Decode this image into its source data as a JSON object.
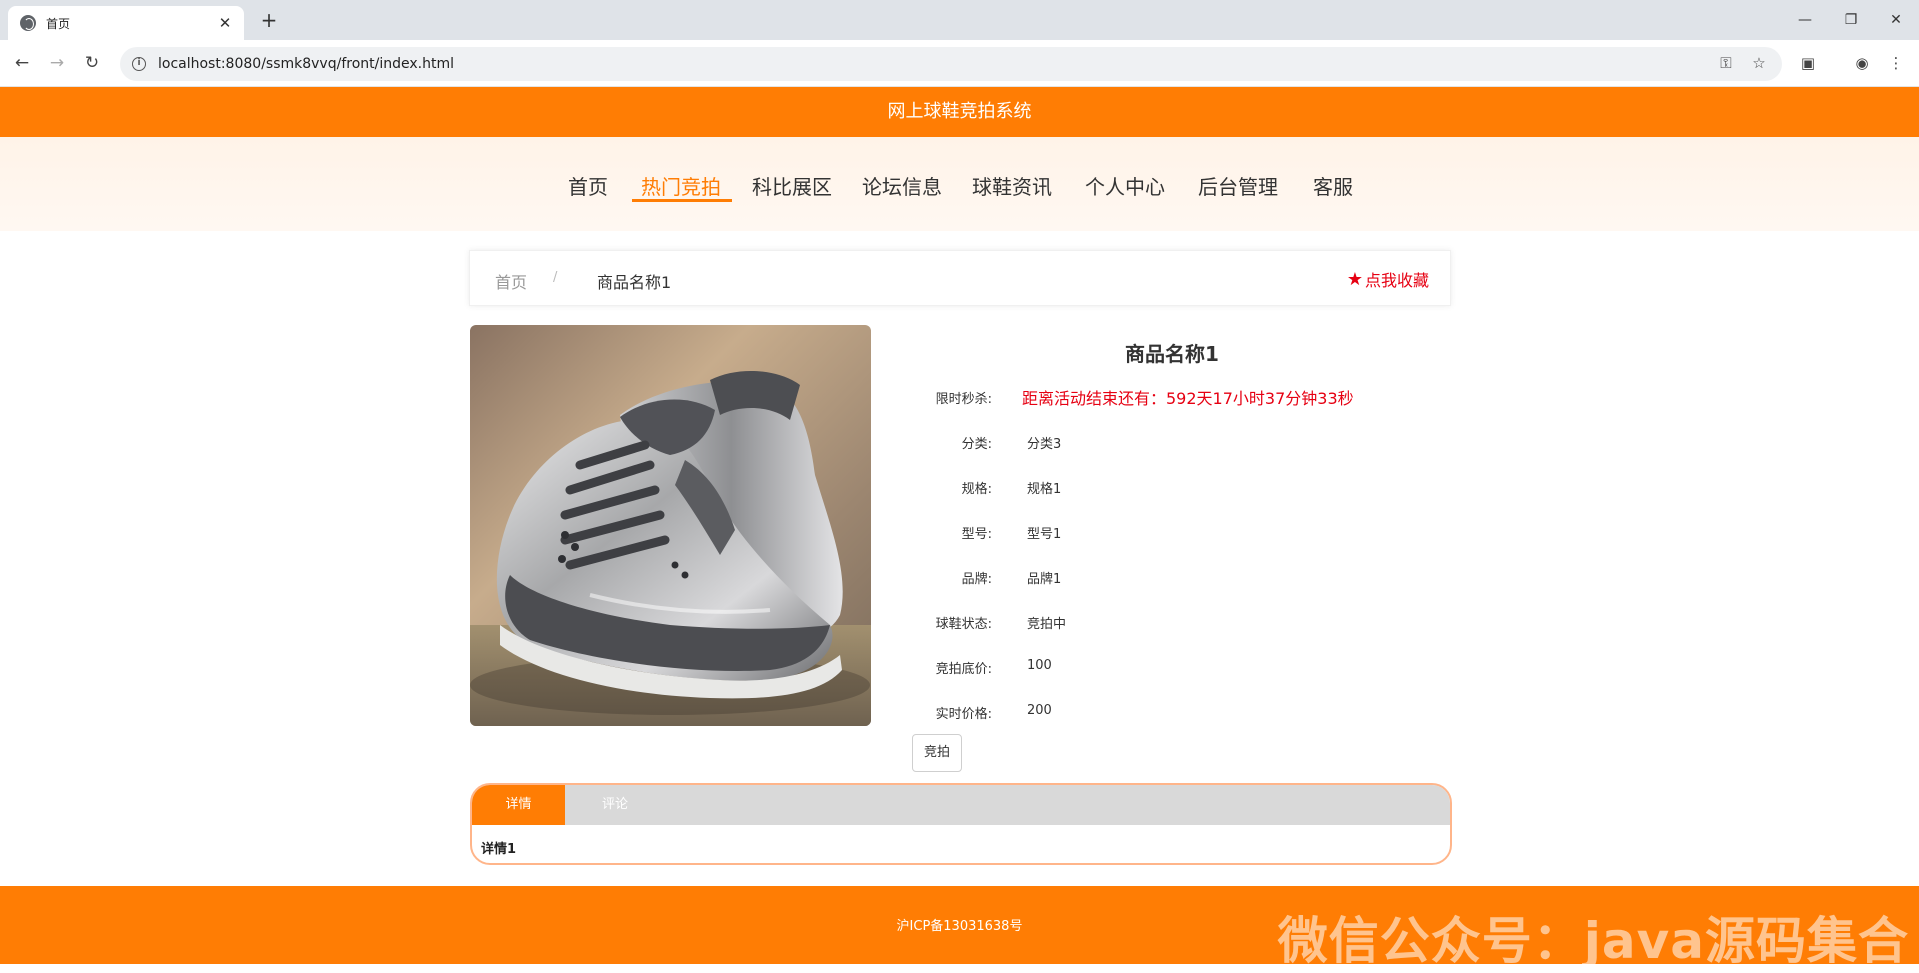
{
  "browser": {
    "tab_title": "首页",
    "url": "localhost:8080/ssmk8vvq/front/index.html"
  },
  "site": {
    "title": "网上球鞋竞拍系统",
    "nav": [
      {
        "label": "首页",
        "active": false
      },
      {
        "label": "热门竞拍",
        "active": true
      },
      {
        "label": "科比展区",
        "active": false
      },
      {
        "label": "论坛信息",
        "active": false
      },
      {
        "label": "球鞋资讯",
        "active": false
      },
      {
        "label": "个人中心",
        "active": false
      },
      {
        "label": "后台管理",
        "active": false
      },
      {
        "label": "客服",
        "active": false
      }
    ]
  },
  "breadcrumb": {
    "home": "首页",
    "separator": "/",
    "current": "商品名称1",
    "favorite": "点我收藏"
  },
  "product": {
    "name": "商品名称1",
    "flash_sale_label": "限时秒杀:",
    "countdown": "距离活动结束还有：592天17小时37分钟33秒",
    "fields": [
      {
        "label": "分类:",
        "value": "分类3"
      },
      {
        "label": "规格:",
        "value": "规格1"
      },
      {
        "label": "型号:",
        "value": "型号1"
      },
      {
        "label": "品牌:",
        "value": "品牌1"
      },
      {
        "label": "球鞋状态:",
        "value": "竞拍中"
      },
      {
        "label": "竞拍底价:",
        "value": "100"
      },
      {
        "label": "实时价格:",
        "value": "200"
      }
    ],
    "bid_button": "竞拍"
  },
  "tabs": {
    "detail": "详情",
    "comment": "评论",
    "content": "详情1"
  },
  "footer": {
    "icp": "沪ICP备13031638号",
    "watermark": "微信公众号：java源码集合"
  },
  "colors": {
    "brand": "#ff7d04",
    "alert": "#e60012"
  }
}
